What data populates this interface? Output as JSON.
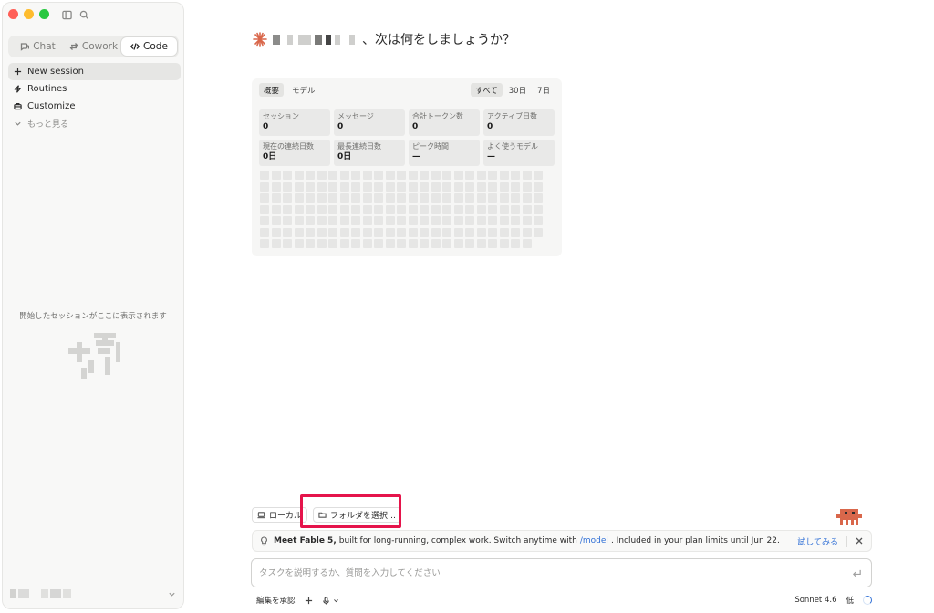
{
  "sidebar": {
    "modes": [
      {
        "label": "Chat",
        "icon": "chat-icon"
      },
      {
        "label": "Cowork",
        "icon": "cowork-icon"
      },
      {
        "label": "Code",
        "icon": "code-icon",
        "active": true
      }
    ],
    "nav": [
      {
        "label": "New session",
        "icon": "plus-icon",
        "active": true
      },
      {
        "label": "Routines",
        "icon": "lightning-icon"
      },
      {
        "label": "Customize",
        "icon": "briefcase-icon"
      },
      {
        "label": "もっと見る",
        "icon": "chevron-down-icon"
      }
    ],
    "empty_message": "開始したセッションがここに表示されます"
  },
  "main": {
    "greeting": "、次は何をしましょうか？",
    "stats": {
      "tabs": [
        "概要",
        "モデル"
      ],
      "ranges": [
        "すべて",
        "30日",
        "7日"
      ],
      "cards": [
        {
          "label": "セッション",
          "value": "0"
        },
        {
          "label": "メッセージ",
          "value": "0"
        },
        {
          "label": "合計トークン数",
          "value": "0"
        },
        {
          "label": "アクティブ日数",
          "value": "0"
        },
        {
          "label": "現在の連続日数",
          "value": "0日"
        },
        {
          "label": "最長連続日数",
          "value": "0日"
        },
        {
          "label": "ピーク時間",
          "value": "—"
        },
        {
          "label": "よく使うモデル",
          "value": "—"
        }
      ]
    }
  },
  "composer": {
    "local_label": "ローカル",
    "folder_label": "フォルダを選択…",
    "banner": {
      "bold": "Meet Fable 5,",
      "text1": "built for long-running, complex work. Switch anytime with",
      "link": "/model",
      "text2": ". Included in your plan limits until Jun 22.",
      "action": "試してみる"
    },
    "input_placeholder": "タスクを説明するか、質問を入力してください",
    "footer": {
      "approve_label": "編集を承認",
      "model": "Sonnet 4.6",
      "effort": "低"
    }
  },
  "colors": {
    "accent_red": "#e5144b",
    "link_blue": "#2f6fd6",
    "brand_orange": "#d9674b"
  }
}
